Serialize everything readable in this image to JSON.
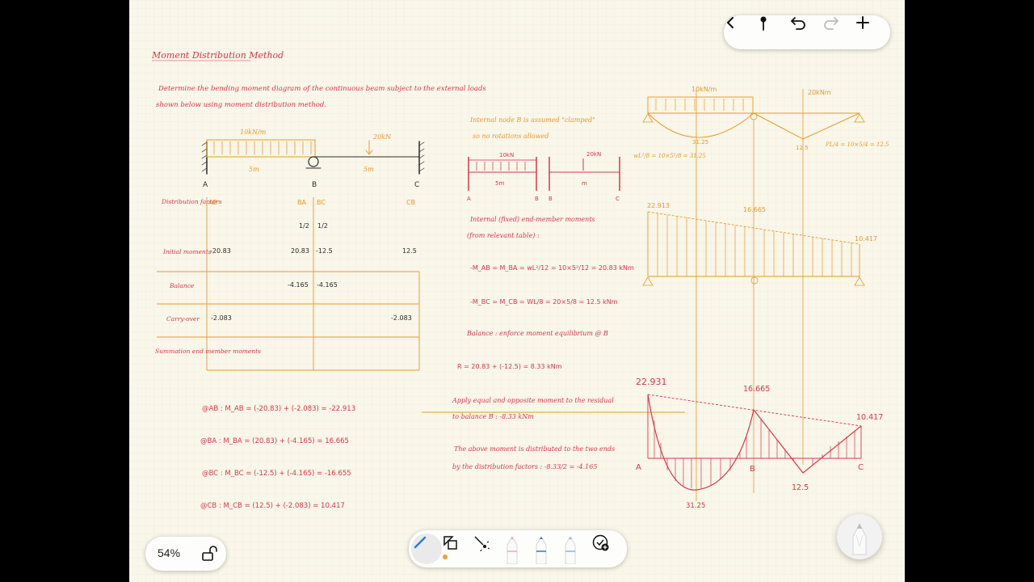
{
  "toolbar": {
    "icons": [
      "back-icon",
      "pin-icon",
      "undo-icon",
      "redo-icon",
      "add-icon"
    ]
  },
  "zoom": {
    "label": "54%",
    "icon": "unlock-icon"
  },
  "tools": {
    "icons": [
      "pen-tool-icon",
      "shapes-tool-icon",
      "laser-pointer-icon",
      "pencil-red-icon",
      "pencil-blue-icon",
      "pencil-lightblue-icon",
      "add-tool-icon"
    ]
  },
  "note": {
    "title": "Moment Distribution Method",
    "problem_line1": "Determine the bending moment diagram of the continuous beam subject to the external loads",
    "problem_line2": "shown below using moment distribution method.",
    "beam": {
      "udl_label": "10kN/m",
      "point_label": "20kN",
      "span1": "5m",
      "span2": "5m",
      "node_a": "A",
      "node_b": "B",
      "node_c": "C"
    },
    "table": {
      "row_head_df": "Distribution factors",
      "row_head_initial": "Initial moments",
      "row_head_balance": "Balance",
      "row_head_carry": "Carry-over",
      "row_head_sum": "Summation end member moments",
      "col_ab": "AB",
      "col_ba": "BA",
      "col_bc": "BC",
      "col_cb": "CB",
      "df_ba": "1/2",
      "df_bc": "1/2",
      "init_ab": "-20.83",
      "init_ba": "20.83",
      "init_bc": "-12.5",
      "init_cb": "12.5",
      "bal_ba": "-4.165",
      "bal_bc": "-4.165",
      "carry_ab": "-2.083",
      "carry_cb": "-2.083"
    },
    "sums": {
      "ab": "@AB :  M_AB = (-20.83) + (-2.083) = -22.913",
      "ba": "@BA :  M_BA = (20.83) + (-4.165) = 16.665",
      "bc": "@BC :  M_BC = (-12.5) + (-4.165) = -16.655",
      "cb": "@CB :  M_CB = (12.5) + (-2.083) = 10.417"
    },
    "middle": {
      "clamped_1": "Internal node B is assumed \"clamped\"",
      "clamped_2": "so no rotations allowed",
      "small_udl": "10kN",
      "small_point": "20kN",
      "small_span1": "5m",
      "small_span2": "m",
      "fem_1": "Internal (fixed) end-member moments",
      "fem_2": "(from relevant table) :",
      "fem_ab": "-M_AB = M_BA = wL²/12 = 10×5²/12 = 20.83 kNm",
      "fem_bc": "-M_BC = M_CB = WL/8 = 20×5/8 = 12.5 kNm",
      "balance": "Balance : enforce moment equilibrium @ B",
      "r": "R = 20.83 + (-12.5) = 8.33 kNm",
      "apply_1": "Apply equal and opposite moment to the residual",
      "apply_2": "to balance B :  -8.33 kNm",
      "dist_1": "The above moment is distributed to the two ends",
      "dist_2": "by the distribution factors :  -8.33/2 = -4.165"
    },
    "right": {
      "udl": "10kN/m",
      "point": "20kNm",
      "free1": "wL²/8 = 10×5²/8 = 31.25",
      "free1_val": "31.25",
      "free2": "PL/4 = 10×5/4 = 12.5",
      "free2_val": "12.5",
      "fixed_a": "22.913",
      "fixed_b": "16.665",
      "fixed_c": "10.417",
      "bmd_a": "22.931",
      "bmd_b": "16.665",
      "bmd_c": "10.417",
      "bmd_span2": "12.5",
      "bmd_span1": "31.25",
      "label_a": "A",
      "label_b": "B",
      "label_c": "C"
    }
  }
}
